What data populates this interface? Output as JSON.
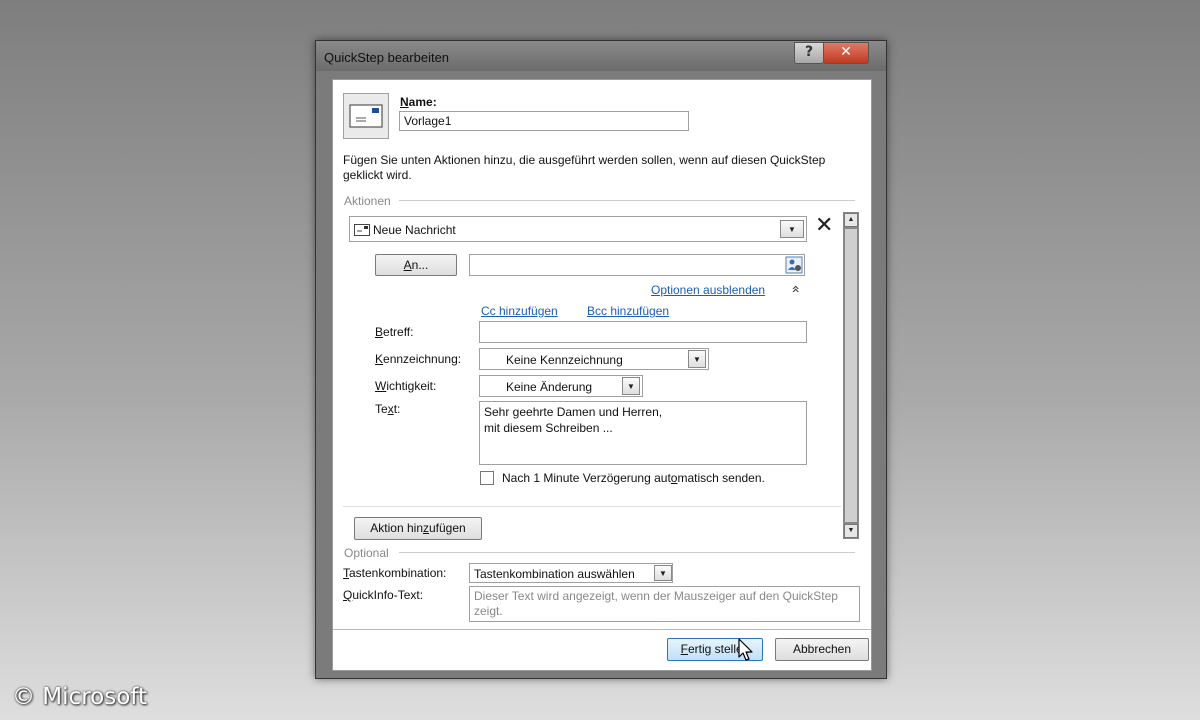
{
  "watermark": "© Microsoft",
  "window": {
    "title": "QuickStep bearbeiten",
    "help_label": "?",
    "close_label": "✕"
  },
  "name_section": {
    "label": "Name:",
    "value": "Vorlage1",
    "instructions": "Fügen Sie unten Aktionen hinzu, die ausgeführt werden sollen, wenn auf diesen QuickStep geklickt wird."
  },
  "actions": {
    "section_label": "Aktionen",
    "action_type": "Neue Nachricht",
    "remove_label": "✕",
    "to_button": "An...",
    "to_value": "",
    "hide_options_link": "Optionen ausblenden",
    "collapse_glyph": "«",
    "cc_link": "Cc hinzufügen",
    "bcc_link": "Bcc hinzufügen",
    "subject_label": "Betreff:",
    "subject_value": "",
    "flag_label": "Kennzeichnung:",
    "flag_value": "Keine Kennzeichnung",
    "importance_label": "Wichtigkeit:",
    "importance_value": "Keine Änderung",
    "text_label": "Text:",
    "text_value": "Sehr geehrte Damen und Herren,\nmit diesem Schreiben ...",
    "delay_label": "Nach 1 Minute Verzögerung automatisch senden.",
    "delay_checked": false,
    "add_action_button": "Aktion hinzufügen"
  },
  "optional": {
    "section_label": "Optional",
    "shortcut_label": "Tastenkombination:",
    "shortcut_value": "Tastenkombination auswählen",
    "tooltip_label": "QuickInfo-Text:",
    "tooltip_placeholder": "Dieser Text wird angezeigt, wenn der Mauszeiger auf den QuickStep zeigt."
  },
  "footer": {
    "finish_button": "Fertig stellen",
    "cancel_button": "Abbrechen"
  },
  "icons": {
    "template": "envelope-icon",
    "action": "envelope-icon",
    "address_book": "address-book-icon",
    "dropdown": "chevron-down-icon",
    "collapse": "double-chevron-up-icon",
    "cursor": "mouse-cursor-icon"
  }
}
